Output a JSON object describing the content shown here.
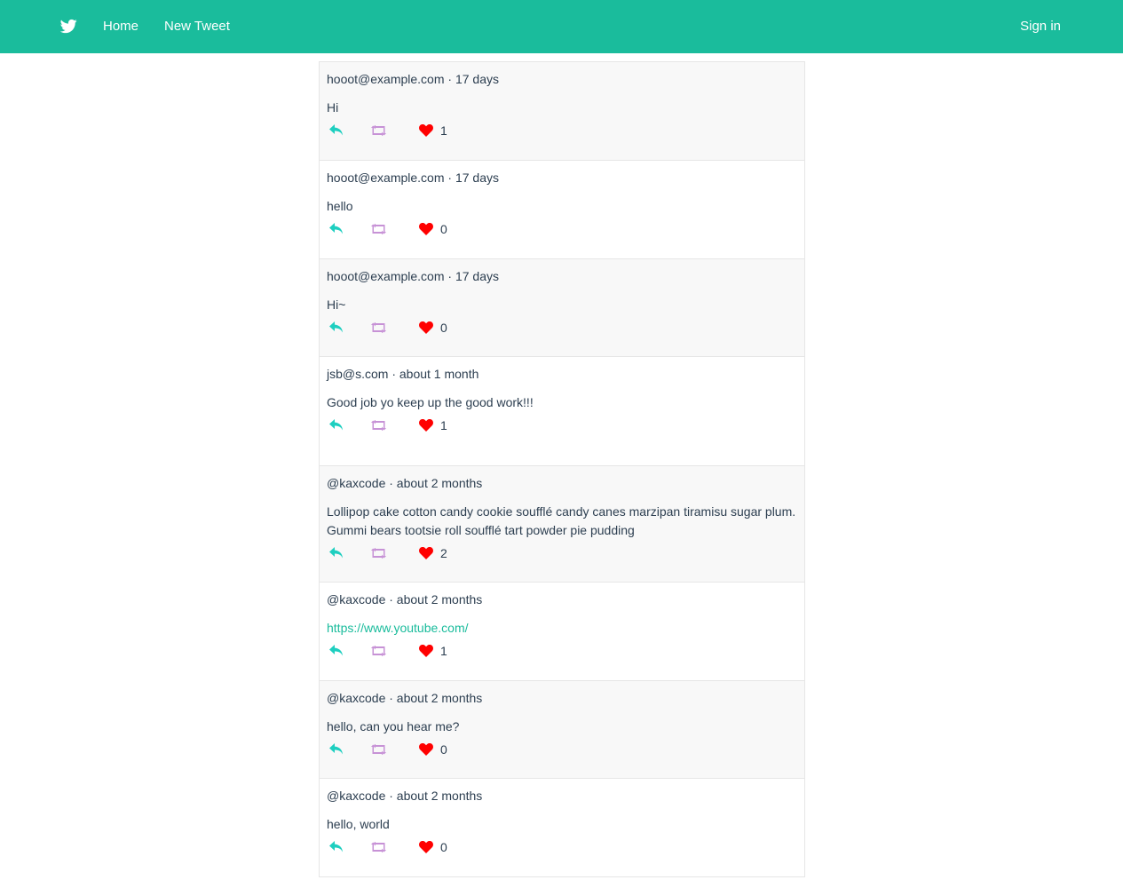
{
  "nav": {
    "logo_icon": "twitter-bird-icon",
    "home_label": "Home",
    "new_tweet_label": "New Tweet",
    "signin_label": "Sign in",
    "bg_color": "#1abc9c"
  },
  "colors": {
    "reply_icon": "#1ecfc0",
    "retweet_icon": "#c792d6",
    "heart_icon": "#ff0000",
    "link": "#1abc9c"
  },
  "tweets": [
    {
      "meta": "hooot@example.com · 17 days",
      "body": "Hi",
      "likes": "1",
      "is_link": false
    },
    {
      "meta": "hooot@example.com · 17 days",
      "body": "hello",
      "likes": "0",
      "is_link": false
    },
    {
      "meta": "hooot@example.com · 17 days",
      "body": "Hi~",
      "likes": "0",
      "is_link": false
    },
    {
      "meta": "jsb@s.com · about 1 month",
      "body": "Good job yo keep up the good work!!!",
      "likes": "1",
      "is_link": false
    },
    {
      "meta": "@kaxcode · about 2 months",
      "body": "Lollipop cake cotton candy cookie soufflé candy canes marzipan tiramisu sugar plum. Gummi bears tootsie roll soufflé tart powder pie pudding",
      "likes": "2",
      "is_link": false
    },
    {
      "meta": "@kaxcode · about 2 months",
      "body": "https://www.youtube.com/",
      "likes": "1",
      "is_link": true
    },
    {
      "meta": "@kaxcode · about 2 months",
      "body": "hello, can you hear me?",
      "likes": "0",
      "is_link": false
    },
    {
      "meta": "@kaxcode · about 2 months",
      "body": "hello, world",
      "likes": "0",
      "is_link": false
    }
  ]
}
